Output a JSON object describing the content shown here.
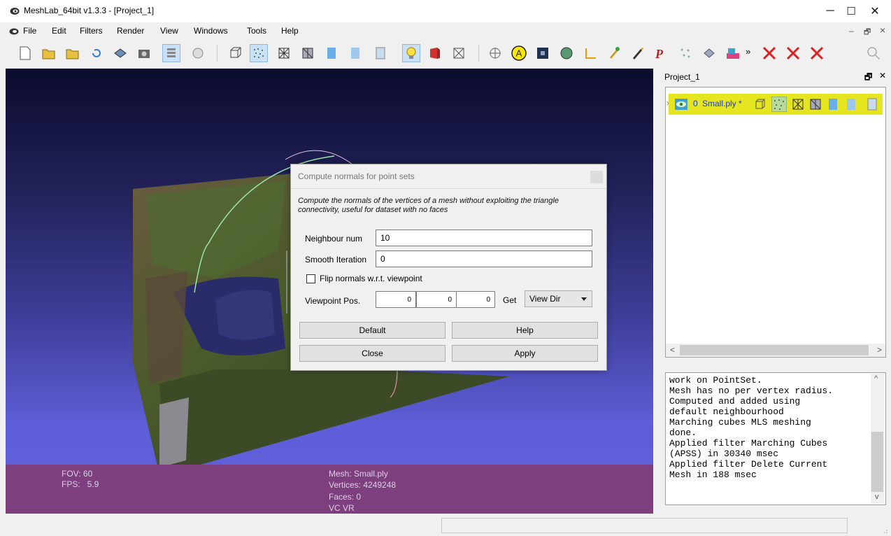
{
  "window": {
    "title": "MeshLab_64bit v1.3.3 - [Project_1]",
    "min_glyph": "─",
    "max_glyph": "☐",
    "close_glyph": "✕"
  },
  "menu": [
    "File",
    "Edit",
    "Filters",
    "Render",
    "View",
    "Windows",
    "Tools",
    "Help"
  ],
  "mdi_controls": {
    "min": "–",
    "restore": "🗗",
    "close": "×"
  },
  "toolbar": {
    "overflow": "»"
  },
  "viewport": {
    "fov": "FOV: 60",
    "fps": "FPS:   5.9",
    "mesh": "Mesh: Small.ply",
    "vertices": "Vertices: 4249248",
    "faces": "Faces: 0",
    "vc": "VC VR"
  },
  "dialog": {
    "title": "Compute normals for point sets",
    "description": "Compute the normals of the vertices of a mesh without exploiting the triangle connectivity, useful for dataset with no faces",
    "neighbour_label": "Neighbour num",
    "neighbour_value": "10",
    "smooth_label": "Smooth Iteration",
    "smooth_value": "0",
    "flip_label": "Flip normals w.r.t. viewpoint",
    "flip_checked": false,
    "viewpoint_label": "Viewpoint Pos.",
    "viewpoint_x": "0",
    "viewpoint_y": "0",
    "viewpoint_z": "0",
    "get_label": "Get",
    "get_select": "View Dir",
    "default_btn": "Default",
    "help_btn": "Help",
    "close_btn": "Close",
    "apply_btn": "Apply"
  },
  "dock": {
    "title": "Project_1",
    "float_glyph": "🗗",
    "close_glyph": "✕",
    "layer": {
      "index": "0",
      "name": "Small.ply *"
    },
    "scroll_left": "<",
    "scroll_right": ">"
  },
  "log": {
    "lines": "work on PointSet.\nMesh has no per vertex radius.\nComputed and added using\ndefault neighbourhood\nMarching cubes MLS meshing\ndone.\nApplied filter Marching Cubes\n(APSS) in 30340 msec\nApplied filter Delete Current\nMesh in 188 msec",
    "scroll_up": "^",
    "scroll_down": "v"
  },
  "colors": {
    "layer_highlight": "#e5e520",
    "overlay": "#7d3f7d",
    "viewport_bottom": "#5e5ed8"
  }
}
